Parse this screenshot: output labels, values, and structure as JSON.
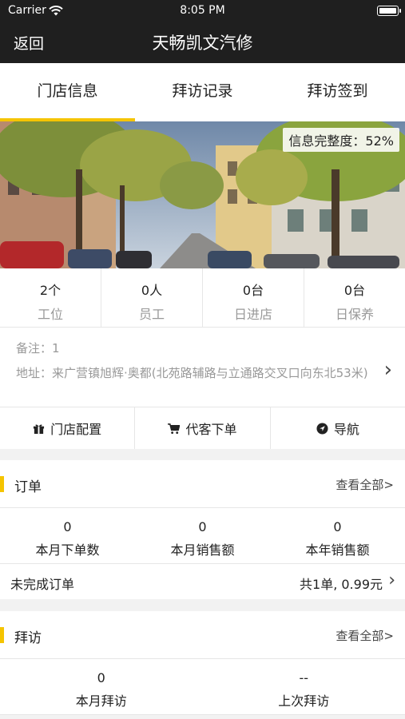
{
  "status_bar": {
    "carrier": "Carrier",
    "time": "8:05 PM"
  },
  "nav": {
    "back_label": "返回",
    "title": "天畅凯文汽修"
  },
  "tabs": [
    {
      "label": "门店信息",
      "active": true
    },
    {
      "label": "拜访记录",
      "active": false
    },
    {
      "label": "拜访签到",
      "active": false
    }
  ],
  "hero": {
    "completeness": "信息完整度：52%"
  },
  "stats": [
    {
      "value": "2个",
      "label": "工位"
    },
    {
      "value": "0人",
      "label": "员工"
    },
    {
      "value": "0台",
      "label": "日进店"
    },
    {
      "value": "0台",
      "label": "日保养"
    }
  ],
  "info": {
    "remark": "备注：1",
    "address": "地址：来广营镇旭辉·奥都(北苑路辅路与立通路交叉口向东北53米)"
  },
  "actions": [
    {
      "label": "门店配置",
      "icon": "gift-icon"
    },
    {
      "label": "代客下单",
      "icon": "cart-icon"
    },
    {
      "label": "导航",
      "icon": "navigation-icon"
    }
  ],
  "orders": {
    "title": "订单",
    "view_all": "查看全部>",
    "metrics": [
      {
        "value": "0",
        "label": "本月下单数"
      },
      {
        "value": "0",
        "label": "本月销售额"
      },
      {
        "value": "0",
        "label": "本年销售额"
      }
    ],
    "unfinished_label": "未完成订单",
    "unfinished_value": "共1单, 0.99元"
  },
  "visits": {
    "title": "拜访",
    "view_all": "查看全部>",
    "metrics": [
      {
        "value": "0",
        "label": "本月拜访"
      },
      {
        "value": "--",
        "label": "上次拜访"
      }
    ]
  },
  "colors": {
    "accent": "#f5c400",
    "topbar": "#1f1f1f",
    "background": "#f2f2f2"
  }
}
